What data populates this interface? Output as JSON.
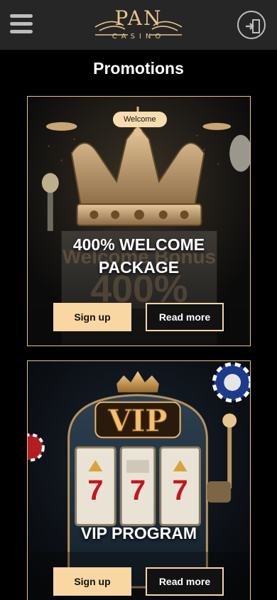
{
  "header": {
    "logo_word": "PAN",
    "logo_sub": "CASINO",
    "menu_icon": "hamburger-menu-icon",
    "login_icon": "login-door-icon"
  },
  "page": {
    "title": "Promotions"
  },
  "promotions": [
    {
      "badge": "Welcome",
      "title": "400% WELCOME PACKAGE",
      "image_text_1": "Welcome Bonus",
      "image_text_2": "400%",
      "primary_label": "Sign up",
      "secondary_label": "Read more"
    },
    {
      "title": "VIP PROGRAM",
      "image_text": "VIP",
      "reel_symbols": [
        "7",
        "7",
        "7"
      ],
      "primary_label": "Sign up",
      "secondary_label": "Read more"
    }
  ],
  "colors": {
    "accent": "#f8d7a3",
    "gold": "#e6c48d",
    "topbar": "#262626",
    "background": "#000000"
  }
}
